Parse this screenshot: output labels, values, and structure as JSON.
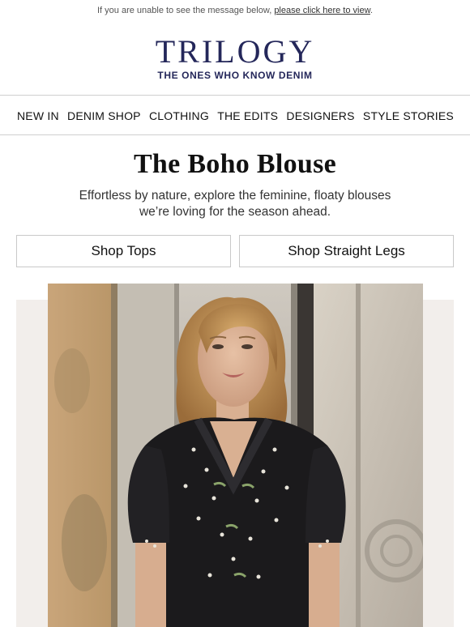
{
  "preheader": {
    "text": "If you are unable to see the message below, ",
    "link": "please click here to view",
    "end": "."
  },
  "brand": {
    "logo": "TRILOGY",
    "tagline": "THE ONES WHO KNOW DENIM",
    "color": "#24275a"
  },
  "nav": {
    "items": [
      {
        "label": "NEW IN"
      },
      {
        "label": "DENIM SHOP"
      },
      {
        "label": "CLOTHING"
      },
      {
        "label": "THE EDITS"
      },
      {
        "label": "DESIGNERS"
      },
      {
        "label": "STYLE STORIES"
      }
    ]
  },
  "hero": {
    "title": "The Boho Blouse",
    "line1": "Effortless by nature, explore the feminine, floaty blouses",
    "line2": "we’re loving for the season ahead."
  },
  "buttons": {
    "shop_tops": "Shop Tops",
    "shop_straight_legs": "Shop Straight Legs"
  },
  "image": {
    "description_icon": "model-photo"
  }
}
